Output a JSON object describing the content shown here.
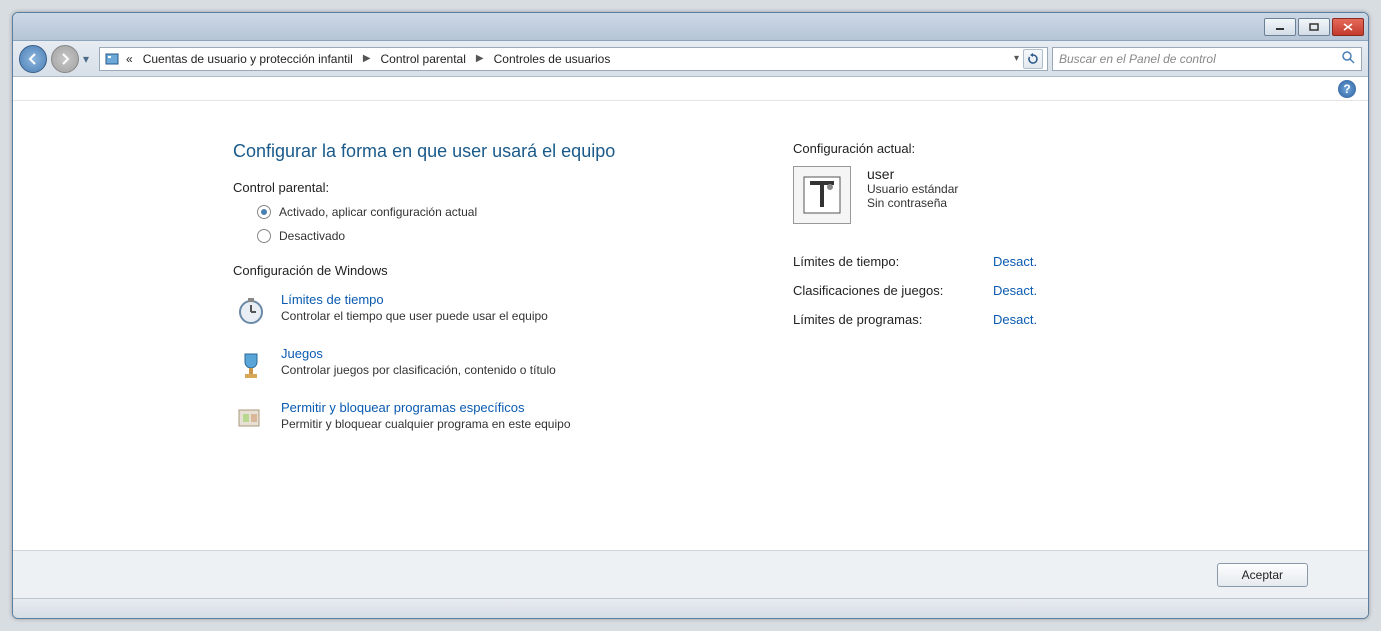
{
  "breadcrumb": {
    "prefix": "«",
    "items": [
      "Cuentas de usuario y protección infantil",
      "Control parental",
      "Controles de usuarios"
    ]
  },
  "search": {
    "placeholder": "Buscar en el Panel de control"
  },
  "heading": "Configurar la forma en que user usará el equipo",
  "parental": {
    "label": "Control parental:",
    "opt_on": "Activado, aplicar configuración actual",
    "opt_off": "Desactivado"
  },
  "windows_cfg_label": "Configuración de Windows",
  "settings": {
    "time": {
      "link": "Límites de tiempo",
      "desc": "Controlar el tiempo que user puede usar el equipo"
    },
    "games": {
      "link": "Juegos",
      "desc": "Controlar juegos por clasificación, contenido o título"
    },
    "programs": {
      "link": "Permitir y bloquear programas específicos",
      "desc": "Permitir y bloquear cualquier programa en este equipo"
    }
  },
  "current_cfg_label": "Configuración actual:",
  "user": {
    "name": "user",
    "role": "Usuario estándar",
    "pw": "Sin contraseña"
  },
  "status": {
    "time": {
      "label": "Límites de tiempo:",
      "value": "Desact."
    },
    "games": {
      "label": "Clasificaciones de juegos:",
      "value": "Desact."
    },
    "programs": {
      "label": "Límites de programas:",
      "value": "Desact."
    }
  },
  "footer": {
    "ok": "Aceptar"
  }
}
